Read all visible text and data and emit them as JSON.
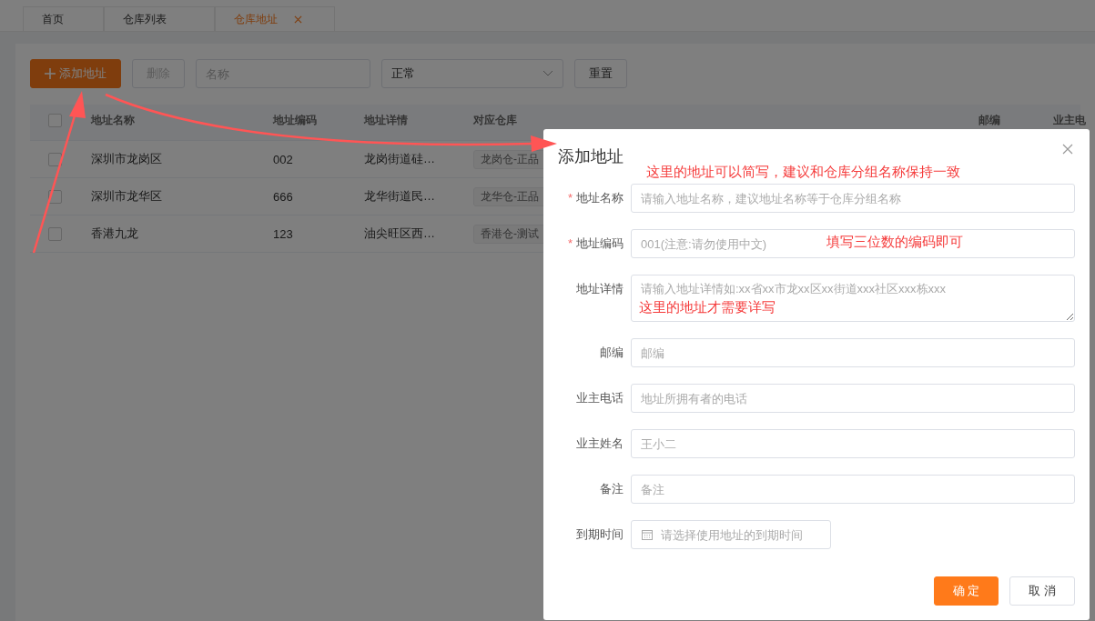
{
  "tabs": [
    {
      "label": "首页",
      "selected": false,
      "closable": false
    },
    {
      "label": "仓库列表",
      "selected": false,
      "closable": false
    },
    {
      "label": "仓库地址",
      "selected": true,
      "closable": true
    }
  ],
  "toolbar": {
    "add_button": "添加地址",
    "delete_button": "删除",
    "name_field": {
      "placeholder": "名称"
    },
    "status_select": {
      "value": "正常"
    },
    "reset_button": "重置"
  },
  "table": {
    "select_all_checked": false,
    "columns": [
      "地址名称",
      "地址编码",
      "地址详情",
      "对应仓库",
      "邮编",
      "业主电"
    ],
    "rows": [
      {
        "checked": false,
        "cells": [
          "深圳市龙岗区",
          "002",
          "龙岗街道硅…",
          "龙岗仓-正品"
        ]
      },
      {
        "checked": false,
        "cells": [
          "深圳市龙华区",
          "666",
          "龙华街道民…",
          "龙华仓-正品"
        ]
      },
      {
        "checked": false,
        "cells": [
          "香港九龙",
          "123",
          "油尖旺区西…",
          "香港仓-测试"
        ]
      }
    ]
  },
  "dialog": {
    "title": "添加地址",
    "required_mark": "*",
    "fields": [
      {
        "kind": "input",
        "label": "地址名称",
        "required": true,
        "placeholder": "请输入地址名称，建议地址名称等于仓库分组名称"
      },
      {
        "kind": "input",
        "label": "地址编码",
        "required": true,
        "placeholder": "001(注意:请勿使用中文)"
      },
      {
        "kind": "textarea",
        "label": "地址详情",
        "required": false,
        "placeholder": "请输入地址详情如:xx省xx市龙xx区xx街道xxx社区xxx栋xxx"
      },
      {
        "kind": "input",
        "label": "邮编",
        "required": false,
        "placeholder": "邮编"
      },
      {
        "kind": "input",
        "label": "业主电话",
        "required": false,
        "placeholder": "地址所拥有者的电话"
      },
      {
        "kind": "input",
        "label": "业主姓名",
        "required": false,
        "placeholder": "王小二"
      },
      {
        "kind": "input",
        "label": "备注",
        "required": false,
        "placeholder": "备注"
      },
      {
        "kind": "date",
        "label": "到期时间",
        "required": false,
        "placeholder": "请选择使用地址的到期时间"
      }
    ],
    "buttons": [
      {
        "label": "确 定",
        "kind": "primary"
      },
      {
        "label": "取 消",
        "kind": "default"
      }
    ]
  },
  "annotations": [
    "这里的地址可以简写，建议和仓库分组名称保持一致",
    "填写三位数的编码即可",
    "这里的地址才需要详写"
  ]
}
